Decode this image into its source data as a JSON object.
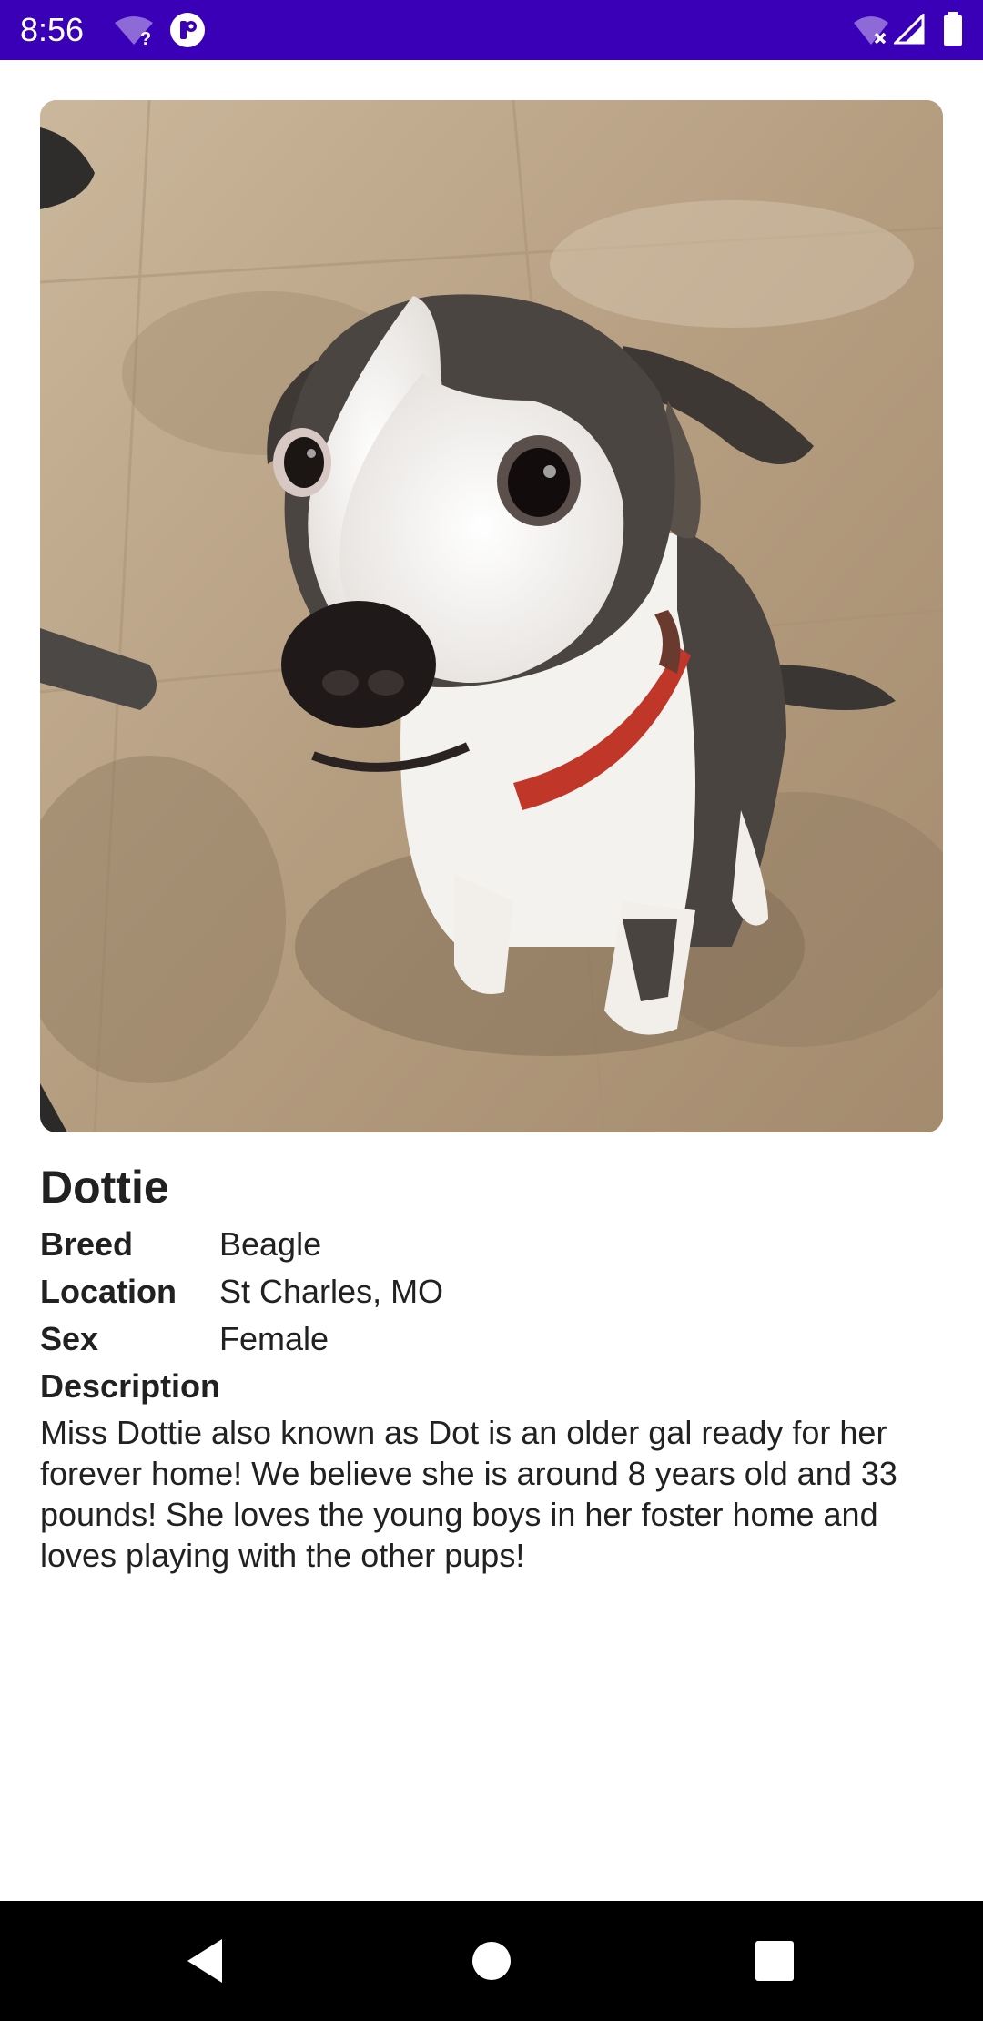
{
  "status_bar": {
    "time": "8:56",
    "icons": [
      "wifi-question-icon",
      "app-notification-icon",
      "wifi-off-icon",
      "cell-signal-icon",
      "battery-icon"
    ],
    "background": "#3a00b8"
  },
  "pet": {
    "photo_icon": "dog-photo",
    "name": "Dottie",
    "details": {
      "breed_label": "Breed",
      "breed_value": "Beagle",
      "location_label": "Location",
      "location_value": "St Charles, MO",
      "sex_label": "Sex",
      "sex_value": "Female",
      "description_label": "Description",
      "description_text": "Miss Dottie also known as Dot is an older gal ready for her forever home! We believe she is around 8 years old and 33 pounds! She loves the young boys in her foster home and loves playing with the other pups!"
    }
  },
  "nav_bar": {
    "buttons": [
      "back-icon",
      "home-icon",
      "recents-icon"
    ],
    "background": "#000000"
  }
}
